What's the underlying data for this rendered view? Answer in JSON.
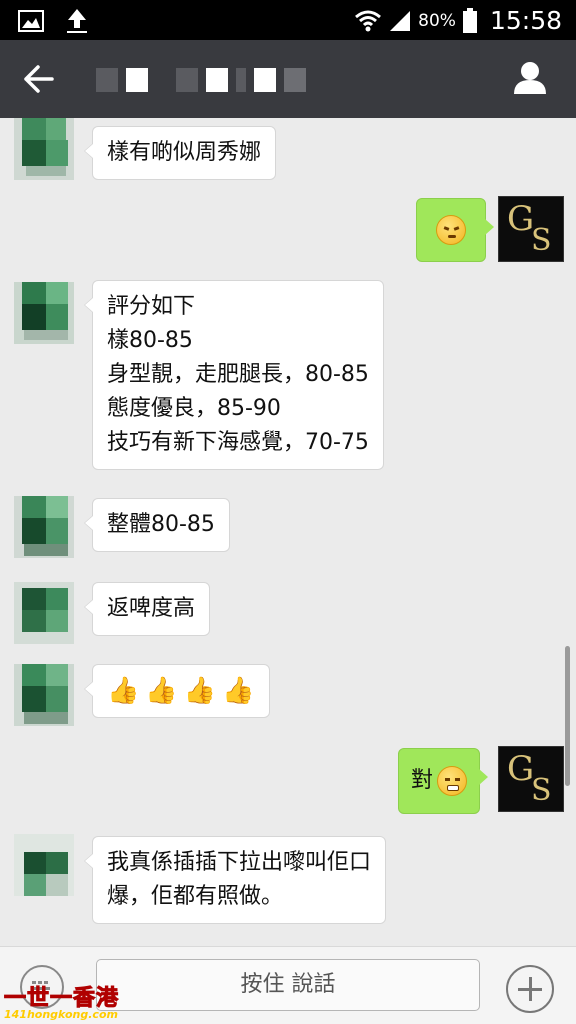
{
  "status_bar": {
    "left_icons": [
      "image-icon",
      "upload-icon"
    ],
    "battery_percent": "80%",
    "time": "15:58"
  },
  "nav": {
    "back_icon": "arrow-left-icon",
    "profile_icon": "person-icon"
  },
  "messages": [
    {
      "side": "left",
      "lines": [
        "樣有啲似周秀娜"
      ]
    },
    {
      "side": "right",
      "type": "emoji",
      "emoji": "annoyed-face-icon"
    },
    {
      "side": "left",
      "lines": [
        "評分如下",
        "樣80-85",
        "身型靚，走肥腿長，80-85",
        "態度優良，85-90",
        "技巧有新下海感覺，70-75"
      ]
    },
    {
      "side": "left",
      "lines": [
        "整體80-85"
      ]
    },
    {
      "side": "left",
      "lines": [
        "返啤度高"
      ]
    },
    {
      "side": "left",
      "type": "emoji",
      "emoji": "thumbs-up-icon",
      "count": 4
    },
    {
      "side": "right",
      "text": "對",
      "emoji": "grinning-face-icon"
    },
    {
      "side": "left",
      "lines": [
        "我真係插插下拉出嚟叫佢口",
        "爆，佢都有照做。"
      ]
    }
  ],
  "avatar_right": {
    "letter_top": "G",
    "letter_bottom": "S",
    "color": "#d8c27a"
  },
  "input_bar": {
    "voice_icon": "voice-keyboard-icon",
    "hold_to_talk": "按住 說話",
    "plus_icon": "plus-icon"
  },
  "watermark": {
    "title": "一世一香港",
    "subtitle": "141hongkong.com"
  }
}
